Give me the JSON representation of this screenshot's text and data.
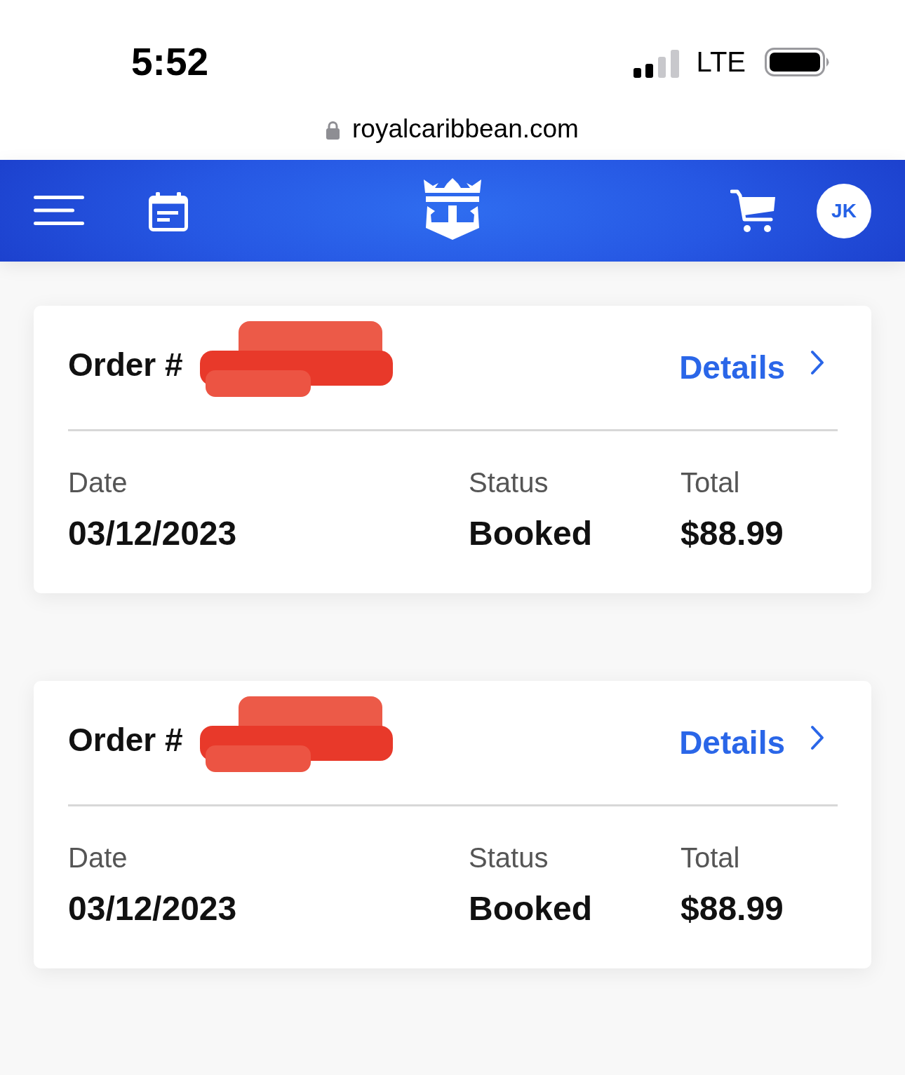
{
  "status_bar": {
    "time": "5:52",
    "network": "LTE"
  },
  "address_bar": {
    "url": "royalcaribbean.com"
  },
  "header": {
    "avatar_initials": "JK"
  },
  "orders": [
    {
      "label": "Order #",
      "redacted": true,
      "details_link": "Details",
      "fields": [
        {
          "label": "Date",
          "value": "03/12/2023"
        },
        {
          "label": "Status",
          "value": "Booked"
        },
        {
          "label": "Total",
          "value": "$88.99"
        }
      ]
    },
    {
      "label": "Order #",
      "redacted": true,
      "details_link": "Details",
      "fields": [
        {
          "label": "Date",
          "value": "03/12/2023"
        },
        {
          "label": "Status",
          "value": "Booked"
        },
        {
          "label": "Total",
          "value": "$88.99"
        }
      ]
    }
  ]
}
